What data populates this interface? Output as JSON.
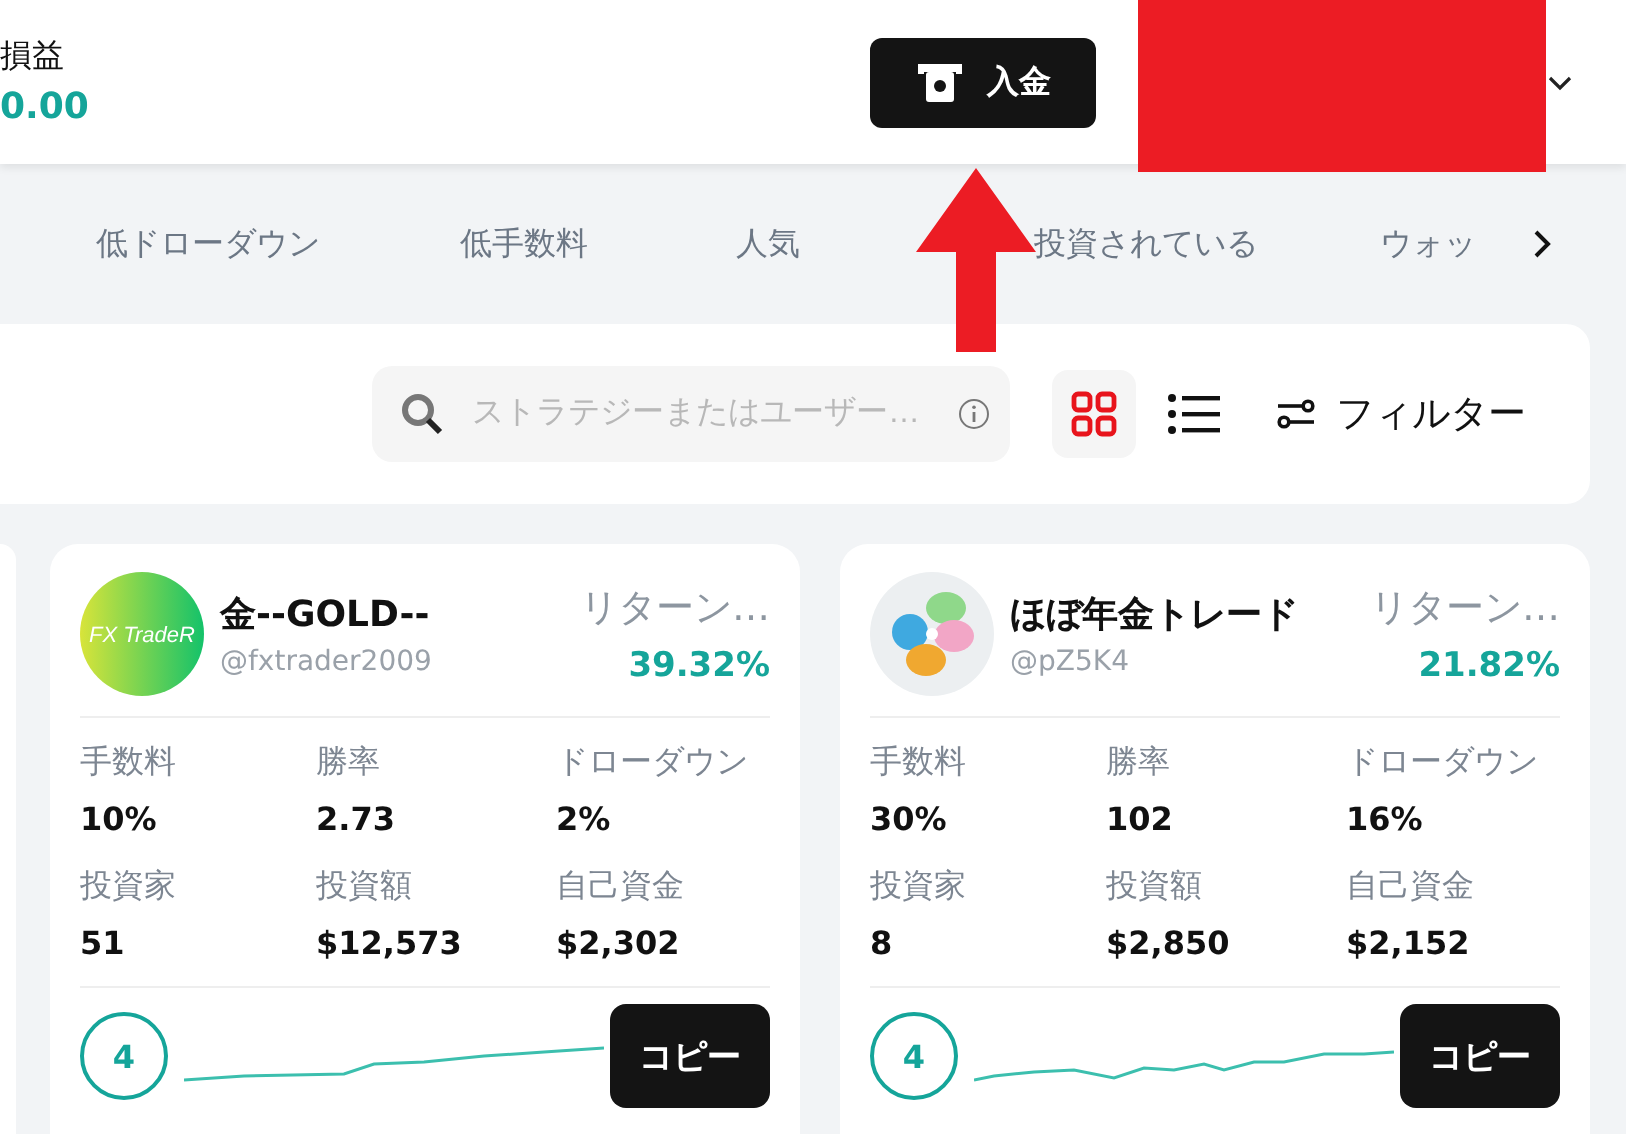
{
  "header": {
    "pnl_label": "損益",
    "pnl_value": "0.00",
    "deposit_button": "入金"
  },
  "tabs": [
    {
      "label": "低ドローダウン",
      "selected": false
    },
    {
      "label": "低手数料",
      "selected": false
    },
    {
      "label": "人気",
      "selected": false
    },
    {
      "label": "投資されている",
      "selected": false
    },
    {
      "label": "ウォッ",
      "selected": false
    }
  ],
  "toolbar": {
    "search": {
      "placeholder": "ストラテジーまたはユーザー…"
    },
    "views": [
      {
        "kind": "grid",
        "selected": true
      },
      {
        "kind": "list",
        "selected": false
      }
    ],
    "filter": "フィルター"
  },
  "cards": [
    {
      "avatar": {
        "kind": "logo",
        "text": "FX TradeR"
      },
      "name": "金--GOLD--",
      "handle": "@fxtrader2009",
      "return_label": "リターン…",
      "return_value": "39.32%",
      "stats": [
        {
          "label": "手数料",
          "value": "10%"
        },
        {
          "label": "勝率",
          "value": "2.73"
        },
        {
          "label": "ドローダウン",
          "value": "2%"
        },
        {
          "label": "投資家",
          "value": "51"
        },
        {
          "label": "投資額",
          "value": "$12,573"
        },
        {
          "label": "自己資金",
          "value": "$2,302"
        }
      ],
      "rank": "4",
      "button": "コピー"
    },
    {
      "name": "ほぼ年金トレード",
      "handle": "@pZ5K4",
      "return_label": "リターン…",
      "return_value": "21.82%",
      "stats": [
        {
          "label": "手数料",
          "value": "30%"
        },
        {
          "label": "勝率",
          "value": "102"
        },
        {
          "label": "ドローダウン",
          "value": "16%"
        },
        {
          "label": "投資家",
          "value": "8"
        },
        {
          "label": "投資額",
          "value": "$2,850"
        },
        {
          "label": "自己資金",
          "value": "$2,152"
        }
      ],
      "rank": "4",
      "button": "コピー"
    }
  ]
}
